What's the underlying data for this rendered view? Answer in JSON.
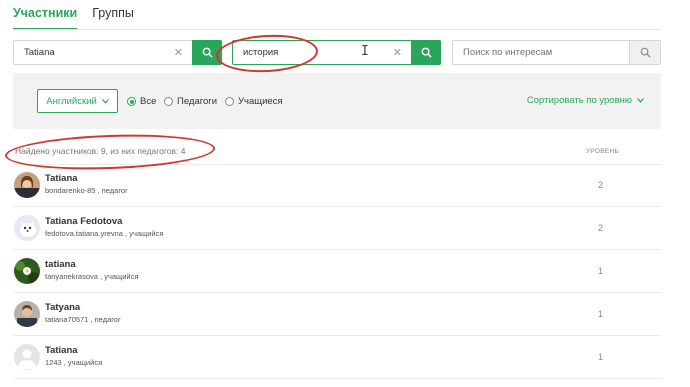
{
  "tabs": [
    {
      "label": "Участники",
      "active": true
    },
    {
      "label": "Группы",
      "active": false
    }
  ],
  "search_name": {
    "value": "Tatiana",
    "clear_icon": "close-icon",
    "button_icon": "search-icon"
  },
  "search_group": {
    "value": "история",
    "clear_icon": "close-icon",
    "button_icon": "search-icon"
  },
  "search_interest": {
    "placeholder": "Поиск по интересам",
    "button_icon": "search-icon"
  },
  "filters": {
    "language": "Английский",
    "roles": [
      {
        "label": "Все",
        "selected": true
      },
      {
        "label": "Педагоги",
        "selected": false
      },
      {
        "label": "Учащиеся",
        "selected": false
      }
    ],
    "sort_label": "Сортировать по уровню"
  },
  "results": {
    "summary": "Найдено участников: 9, из них педагогов: 4",
    "level_header": "УРОВЕНЬ"
  },
  "users": [
    {
      "name": "Tatiana",
      "meta": "bondarenko-85 , педагог",
      "level": "2"
    },
    {
      "name": "Tatiana Fedotova",
      "meta": "fedotova.tatiana.yrevna , учащийся",
      "level": "2"
    },
    {
      "name": "tatiana",
      "meta": "tanyanekrasova , учащийся",
      "level": "1"
    },
    {
      "name": "Tatyana",
      "meta": "tatiana70571 , педагог",
      "level": "1"
    },
    {
      "name": "Tatiana",
      "meta": "1243 , учащийся",
      "level": "1"
    }
  ],
  "colors": {
    "accent": "#2aa65a",
    "annotation": "#d6332f"
  }
}
